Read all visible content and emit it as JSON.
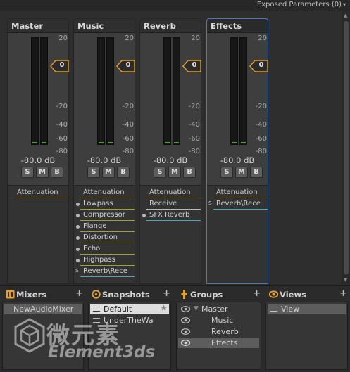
{
  "header": {
    "exposed_params": "Exposed Parameters (0)"
  },
  "scale_labels": [
    "20",
    "0",
    "-20",
    "-40",
    "-60",
    "-80"
  ],
  "groups_strips": [
    {
      "name": "Master",
      "fader_value": "0",
      "db": "-80.0 dB",
      "buttons": {
        "s": "S",
        "m": "M",
        "b": "B"
      },
      "effects": [
        {
          "label": "Attenuation",
          "kind": "atten",
          "marker": ""
        }
      ]
    },
    {
      "name": "Music",
      "fader_value": "0",
      "db": "-80.0 dB",
      "buttons": {
        "s": "S",
        "m": "M",
        "b": "B"
      },
      "effects": [
        {
          "label": "Attenuation",
          "kind": "atten",
          "marker": ""
        },
        {
          "label": "Lowpass",
          "kind": "fx",
          "marker": "dot"
        },
        {
          "label": "Compressor",
          "kind": "fx",
          "marker": "dot"
        },
        {
          "label": "Flange",
          "kind": "fx",
          "marker": "dot"
        },
        {
          "label": "Distortion",
          "kind": "fx",
          "marker": "dot"
        },
        {
          "label": "Echo",
          "kind": "fx",
          "marker": "dot"
        },
        {
          "label": "Highpass",
          "kind": "fx",
          "marker": "dot"
        },
        {
          "label": "Reverb\\Rece",
          "kind": "send",
          "marker": "s"
        }
      ]
    },
    {
      "name": "Reverb",
      "fader_value": "0",
      "db": "-80.0 dB",
      "buttons": {
        "s": "S",
        "m": "M",
        "b": "B"
      },
      "effects": [
        {
          "label": "Attenuation",
          "kind": "atten",
          "marker": ""
        },
        {
          "label": "Receive",
          "kind": "recv",
          "marker": ""
        },
        {
          "label": "SFX Reverb",
          "kind": "cyan",
          "marker": "dot"
        }
      ]
    },
    {
      "name": "Effects",
      "fader_value": "0",
      "db": "-80.0 dB",
      "buttons": {
        "s": "S",
        "m": "M",
        "b": "B"
      },
      "effects": [
        {
          "label": "Attenuation",
          "kind": "atten",
          "marker": ""
        },
        {
          "label": "Reverb\\Rece",
          "kind": "send",
          "marker": "s"
        }
      ]
    }
  ],
  "panels": {
    "mixers": {
      "title": "Mixers",
      "plus": "+",
      "items": [
        "NewAudioMixer"
      ]
    },
    "snapshots": {
      "title": "Snapshots",
      "plus": "+",
      "items": [
        "Default",
        "UnderTheWa"
      ]
    },
    "groups": {
      "title": "Groups",
      "plus": "+",
      "items": [
        "Master",
        "Music",
        "Reverb",
        "Effects"
      ]
    },
    "views": {
      "title": "Views",
      "plus": "+",
      "items": [
        "View"
      ]
    }
  },
  "watermark": {
    "cn": "微元素",
    "en": "Element3ds"
  },
  "colors": {
    "accent_selected": "#4a79c0",
    "meter_green": "#4f9f3b",
    "fader_orange": "#e0a030",
    "send_cyan": "#4aa8b8"
  }
}
